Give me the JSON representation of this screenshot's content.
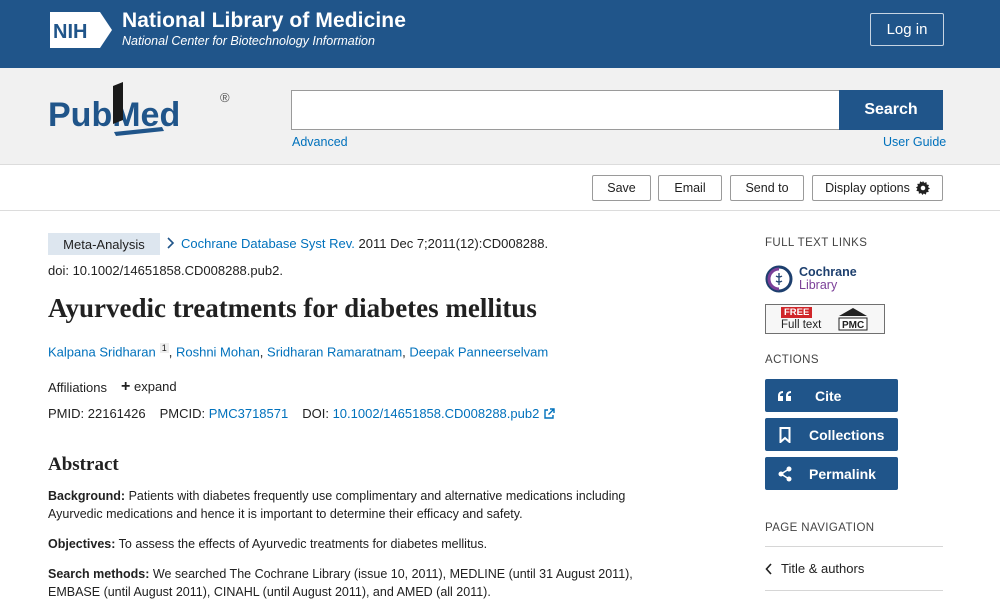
{
  "header": {
    "logo_text": "NIH",
    "title": "National Library of Medicine",
    "subtitle": "National Center for Biotechnology Information",
    "login_label": "Log in",
    "brand_color": "#20558a"
  },
  "search": {
    "logo_text": "PubMed",
    "logo_mark": "®",
    "query": "",
    "button_label": "Search",
    "advanced_label": "Advanced",
    "user_guide_label": "User Guide"
  },
  "toolbar": {
    "save_label": "Save",
    "email_label": "Email",
    "send_label": "Send to",
    "display_label": "Display options"
  },
  "article": {
    "badge": "Meta-Analysis",
    "journal": "Cochrane Database Syst Rev.",
    "citation": " 2011 Dec 7;2011(12):CD008288.",
    "doi_line": "doi: 10.1002/14651858.CD008288.pub2.",
    "title": "Ayurvedic treatments for diabetes mellitus",
    "authors": [
      {
        "name": "Kalpana Sridharan",
        "aff": "1"
      },
      {
        "name": "Roshni Mohan"
      },
      {
        "name": "Sridharan Ramaratnam"
      },
      {
        "name": "Deepak Panneerselvam"
      }
    ],
    "author_separator": ",",
    "affiliations_label": "Affiliations",
    "expand_symbol": "+",
    "expand_label": "expand",
    "pmid_label": "PMID:",
    "pmid": "22161426",
    "pmcid_label": "PMCID:",
    "pmcid": "PMC3718571",
    "doi_label": "DOI:",
    "doi": "10.1002/14651858.CD008288.pub2"
  },
  "abstract": {
    "heading": "Abstract",
    "background_label": "Background:",
    "background_text": " Patients with diabetes frequently use complimentary and alternative medications including Ayurvedic medications and hence it is important to determine their efficacy and safety.",
    "objectives_label": "Objectives:",
    "objectives_text": " To assess the effects of Ayurvedic treatments for diabetes mellitus.",
    "methods_label": "Search methods:",
    "methods_text": " We searched The Cochrane Library (issue 10, 2011), MEDLINE (until 31 August 2011), EMBASE (until August 2011), CINAHL (until August 2011), and AMED (all 2011)."
  },
  "sidebar": {
    "full_text_heading": "FULL TEXT LINKS",
    "cochrane_name": "Cochrane",
    "cochrane_library": "Library",
    "pmc_free": "FREE",
    "pmc_fulltext": "Full text",
    "pmc_mark": "PMC",
    "actions_heading": "ACTIONS",
    "cite_label": "Cite",
    "collections_label": "Collections",
    "permalink_label": "Permalink",
    "nav_heading": "PAGE NAVIGATION",
    "nav_item": "Title & authors"
  },
  "icons": {
    "gear": "gear-icon",
    "chevron": "chevron-right-icon",
    "external": "external-link-icon",
    "quote": "quote-icon",
    "bookmark": "bookmark-icon",
    "share": "share-icon",
    "chevron_left": "chevron-left-icon"
  }
}
